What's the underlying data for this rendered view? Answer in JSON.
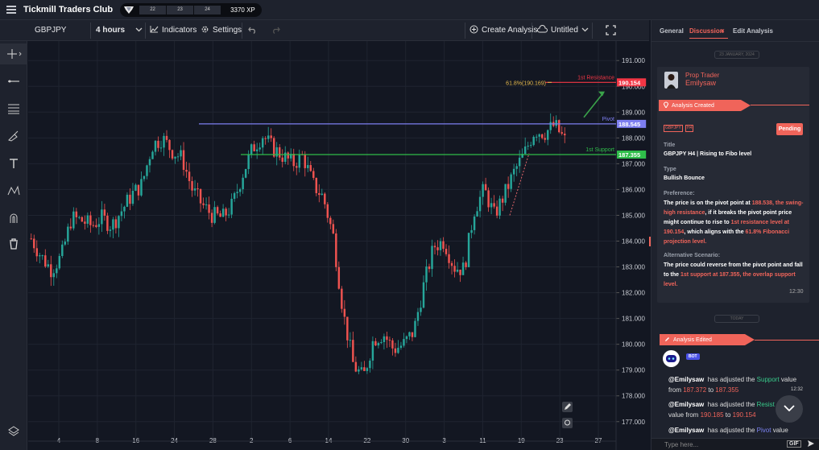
{
  "app": {
    "title": "Tickmill Traders Club",
    "levels": [
      "22",
      "23",
      "24"
    ],
    "xp": "3370 XP"
  },
  "toolbar": {
    "symbol": "GBPJPY",
    "interval": "4 hours",
    "indicators": "Indicators",
    "settings": "Settings",
    "create_analysis": "Create Analysis",
    "layout_name": "Untitled"
  },
  "side": {
    "tabs": [
      "General",
      "Discussion",
      "Edit Analysis"
    ],
    "active_tab": "Discussion",
    "date_chip": "23 JANUARY, 2024",
    "today_chip": "TODAY",
    "author_role": "Prop Trader",
    "author_name": "Emilysaw",
    "analysis_created": "Analysis Created",
    "symbol_tag": "GBPJPY",
    "tf_tag": "H4",
    "status": "Pending",
    "title_label": "Title",
    "title_value": "GBPJPY H4 | Rising to Fibo level",
    "type_label": "Type",
    "type_value": "Bullish Bounce",
    "pref_label": "Preference:",
    "pref_1": "The price is on the pivot point at ",
    "pref_2": "188.538, the swing-high resistance",
    "pref_3": ", if it breaks the pivot point price might continue to rise to ",
    "pref_4": "1st resistance level at 190.154",
    "pref_5": ", which aligns with the ",
    "pref_6": "61.8% Fibonacci projection level.",
    "alt_label": "Alternative Scenario:",
    "alt_1": "The price could reverse from the pivot point and fall to the ",
    "alt_2": "1st support at 187.355, the overlap support level.",
    "card_time": "12:30",
    "analysis_edited": "Analysis Edited",
    "bot_badge": "BOT",
    "m1_user": "@Emilysaw",
    "m1_text": "has adjusted the ",
    "m1_field": "Support",
    "m1_value": "value",
    "m1_from": "from",
    "m1_old": "187.372",
    "m1_to": "to",
    "m1_new": "187.355",
    "m1_time": "12:32",
    "m2_user": "@Emilysaw",
    "m2_text": "has adjusted the ",
    "m2_field": "Resist",
    "m2_value": "value from",
    "m2_old": "190.185",
    "m2_to": "to",
    "m2_new": "190.154",
    "m3_user": "@Emilysaw",
    "m3_text": "has adjusted the ",
    "m3_field": "Pivot",
    "m3_value": "value",
    "input_placeholder": "Type here...",
    "gif": "GIF"
  },
  "chart_data": {
    "type": "candlestick",
    "symbol": "GBPJPY",
    "interval": "4 hours",
    "ylim": [
      176.4,
      191.6
    ],
    "y_ticks": [
      "191.000",
      "190.000",
      "189.000",
      "188.000",
      "187.000",
      "186.000",
      "185.000",
      "184.000",
      "183.000",
      "182.000",
      "181.000",
      "180.000",
      "179.000",
      "178.000",
      "177.000"
    ],
    "x_ticks": [
      "4",
      "8",
      "16",
      "24",
      "28",
      "2",
      "6",
      "14",
      "22",
      "30",
      "3",
      "11",
      "19",
      "23",
      "27"
    ],
    "close_path": [
      184.1,
      183.4,
      182.9,
      183.4,
      184.9,
      184.8,
      184.6,
      184.9,
      184.6,
      185.2,
      185.8,
      186.2,
      187.7,
      188.0,
      187.5,
      187.2,
      186.0,
      185.4,
      185.0,
      184.9,
      185.4,
      186.6,
      187.6,
      188.1,
      187.6,
      187.3,
      187.0,
      187.3,
      186.2,
      185.7,
      184.2,
      181.2,
      179.2,
      178.7,
      180.2,
      180.4,
      179.8,
      180.0,
      180.5,
      182.3,
      183.8,
      184.0,
      183.0,
      182.9,
      185.2,
      186.0,
      185.0,
      185.8,
      186.7,
      187.4,
      188.3,
      188.2,
      188.5,
      187.9
    ],
    "levels": [
      {
        "name": "1st Resistance",
        "value": "190.154",
        "color": "#f23645"
      },
      {
        "name": "Pivot",
        "value": "188.545",
        "color": "#7d7ef0"
      },
      {
        "name": "1st Support",
        "value": "187.355",
        "color": "#2fbd4a"
      }
    ],
    "fib_label": "61.8%(190.169)",
    "colors": {
      "up": "#26a69a",
      "down": "#ef5350"
    }
  }
}
